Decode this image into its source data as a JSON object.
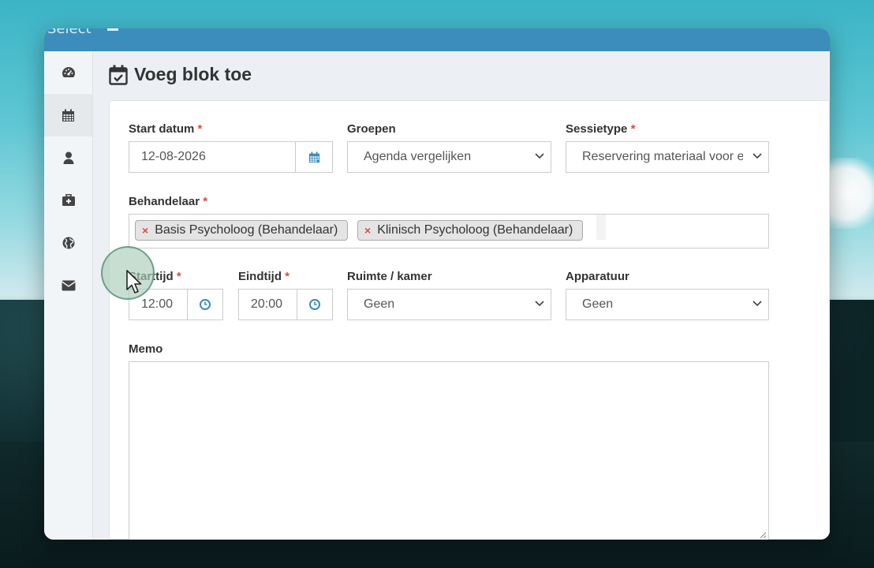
{
  "app": {
    "brand": "Select"
  },
  "sidebar": {
    "items": [
      {
        "icon": "dashboard-icon"
      },
      {
        "icon": "calendar-icon",
        "active": true
      },
      {
        "icon": "user-icon"
      },
      {
        "icon": "medkit-icon"
      },
      {
        "icon": "globe-icon"
      },
      {
        "icon": "envelope-icon"
      }
    ]
  },
  "page": {
    "title": "Voeg blok toe",
    "title_icon": "calendar-check-icon"
  },
  "form": {
    "required_mark": "*",
    "start_date": {
      "label": "Start datum",
      "value": "12-08-2026"
    },
    "groups": {
      "label": "Groepen",
      "value": "Agenda vergelijken"
    },
    "session_type": {
      "label": "Sessietype",
      "value": "Reservering materiaal voor e"
    },
    "practitioner": {
      "label": "Behandelaar",
      "tags": [
        "Basis Psycholoog (Behandelaar)",
        "Klinisch Psycholoog (Behandelaar)"
      ],
      "remove_symbol": "×"
    },
    "start_time": {
      "label": "Starttijd",
      "value": "12:00"
    },
    "end_time": {
      "label": "Eindtijd",
      "value": "20:00"
    },
    "room": {
      "label": "Ruimte / kamer",
      "value": "Geen"
    },
    "equipment": {
      "label": "Apparatuur",
      "value": "Geen"
    },
    "memo": {
      "label": "Memo",
      "value": ""
    }
  },
  "colors": {
    "header": "#3c8dbc",
    "required": "#dd4b39",
    "icon_blue": "#3c8dbc"
  }
}
